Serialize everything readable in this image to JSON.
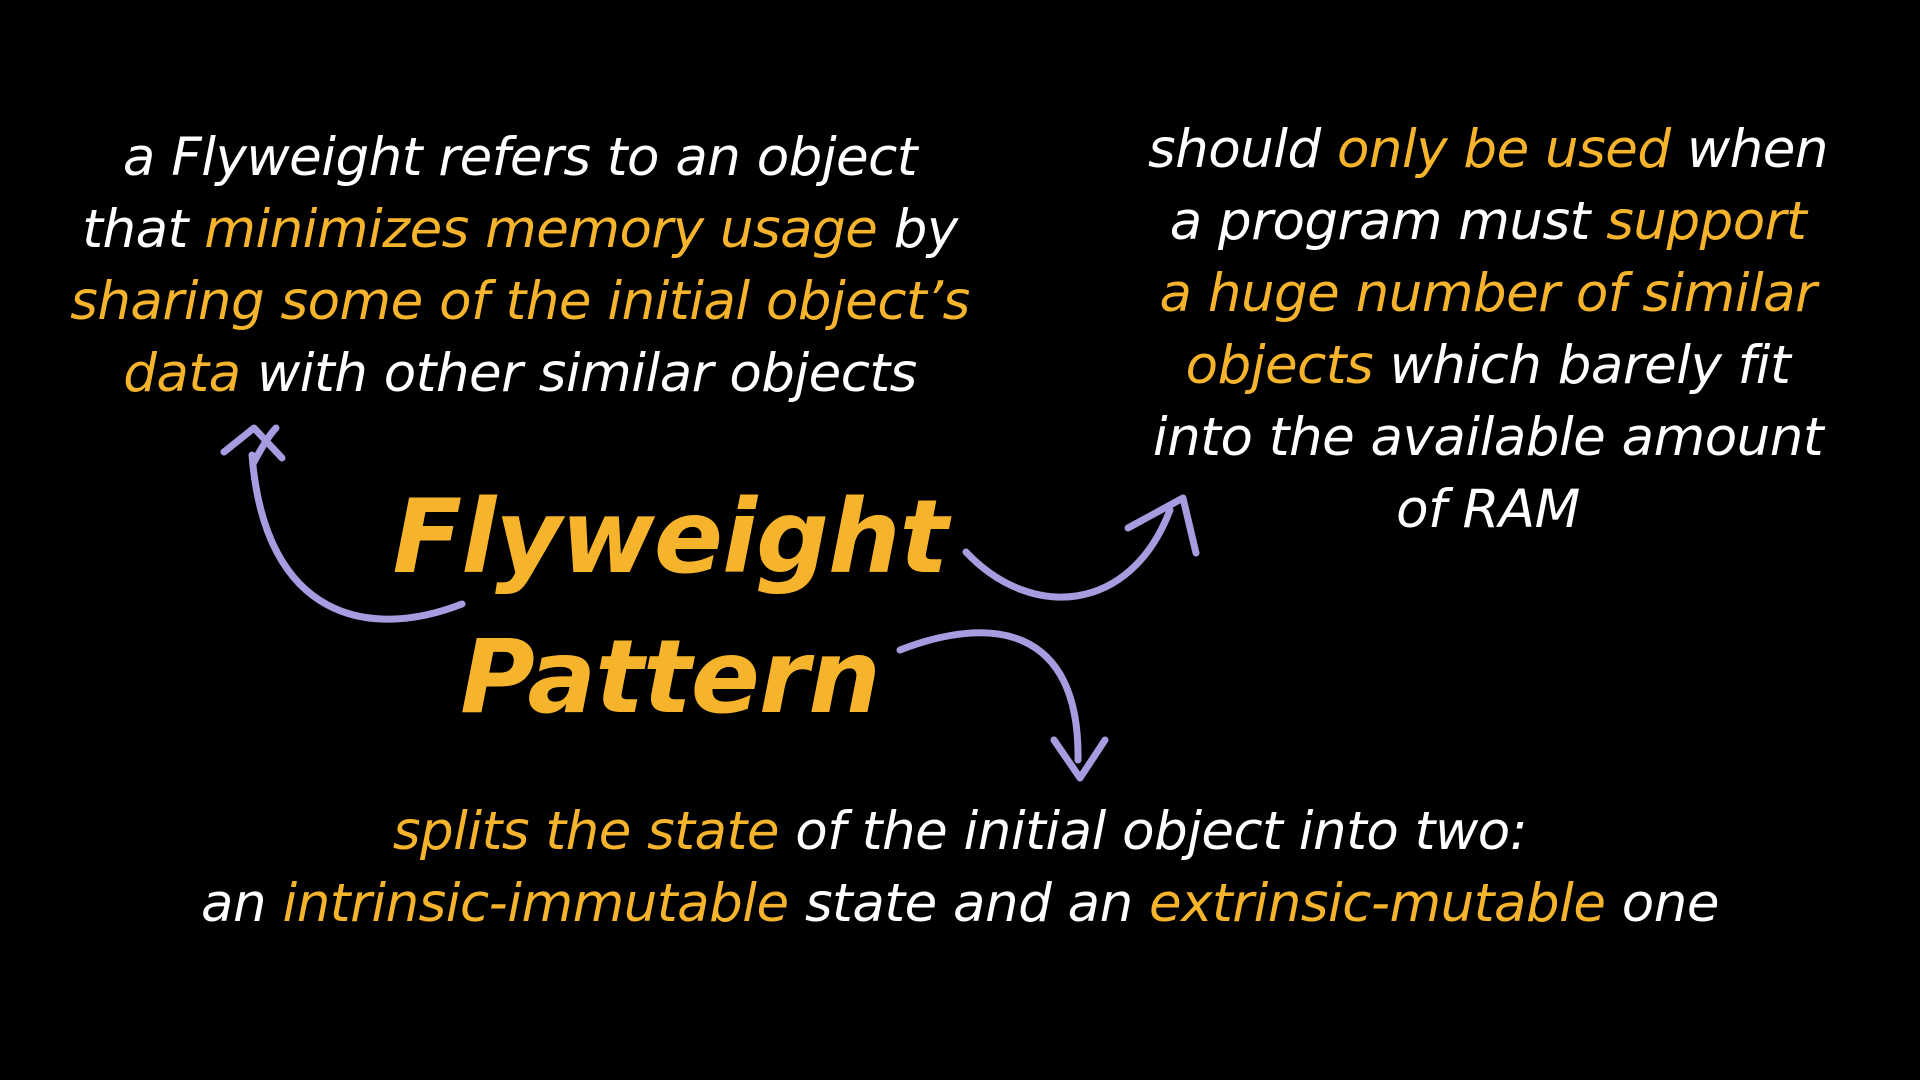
{
  "title": {
    "line1": "Flyweight",
    "line2": "Pattern"
  },
  "definition": {
    "line1": [
      {
        "text": "a Flyweight refers to an object",
        "highlight": false
      }
    ],
    "line2": [
      {
        "text": "that ",
        "highlight": false
      },
      {
        "text": "minimizes memory usage",
        "highlight": true
      },
      {
        "text": " by",
        "highlight": false
      }
    ],
    "line3": [
      {
        "text": "sharing some of the initial object’s",
        "highlight": true
      }
    ],
    "line4": [
      {
        "text": "data",
        "highlight": true
      },
      {
        "text": " with other similar objects",
        "highlight": false
      }
    ]
  },
  "usage": {
    "line1": [
      {
        "text": "should ",
        "highlight": false
      },
      {
        "text": "only be used",
        "highlight": true
      },
      {
        "text": " when",
        "highlight": false
      }
    ],
    "line2": [
      {
        "text": "a program must ",
        "highlight": false
      },
      {
        "text": "support",
        "highlight": true
      }
    ],
    "line3": [
      {
        "text": "a huge number of similar",
        "highlight": true
      }
    ],
    "line4": [
      {
        "text": "objects",
        "highlight": true
      },
      {
        "text": " which barely fit",
        "highlight": false
      }
    ],
    "line5": [
      {
        "text": "into the available amount",
        "highlight": false
      }
    ],
    "line6": [
      {
        "text": "of RAM",
        "highlight": false
      }
    ]
  },
  "state_split": {
    "line1": [
      {
        "text": "splits the state",
        "highlight": true
      },
      {
        "text": " of the initial object into two:",
        "highlight": false
      }
    ],
    "line2": [
      {
        "text": "an ",
        "highlight": false
      },
      {
        "text": "intrinsic-immutable",
        "highlight": true
      },
      {
        "text": " state and an ",
        "highlight": false
      },
      {
        "text": "extrinsic-mutable",
        "highlight": true
      },
      {
        "text": " one",
        "highlight": false
      }
    ]
  },
  "colors": {
    "background": "#000000",
    "text": "#ffffff",
    "highlight": "#f6b42c",
    "arrow": "#a89be0"
  }
}
